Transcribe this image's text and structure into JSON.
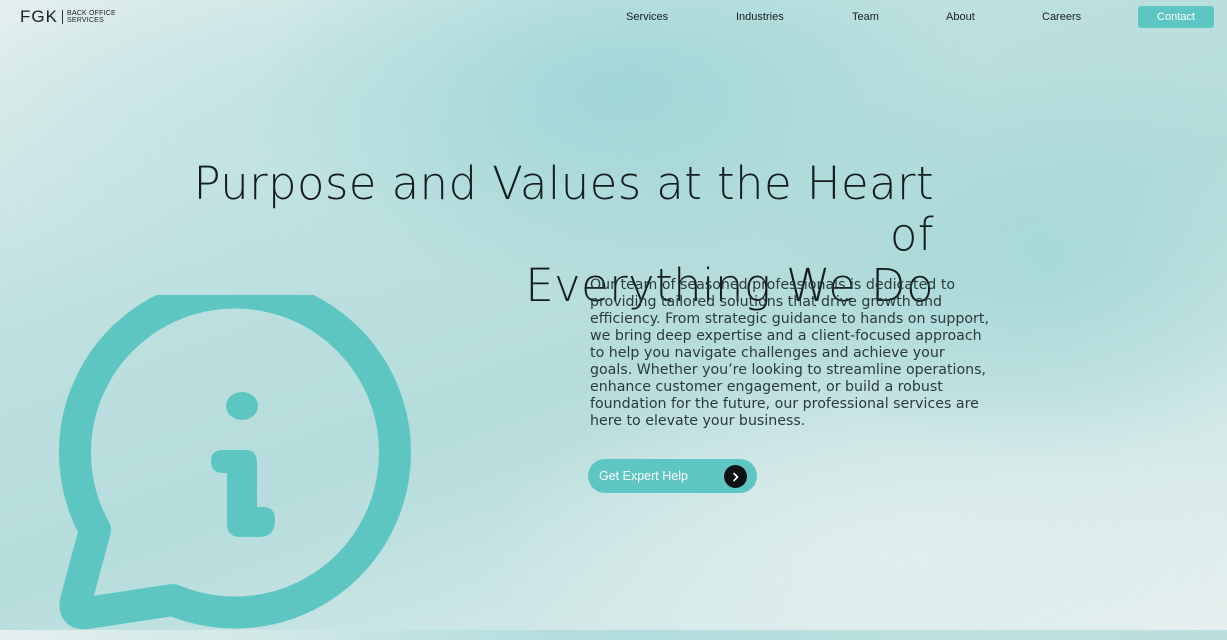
{
  "brand": {
    "mark": "FGK",
    "tagline_line1": "BACK OFFICE",
    "tagline_line2": "SERVICES"
  },
  "nav": {
    "items": [
      {
        "label": "Services"
      },
      {
        "label": "Industries"
      },
      {
        "label": "Team"
      },
      {
        "label": "About"
      },
      {
        "label": "Careers"
      }
    ],
    "contact_label": "Contact"
  },
  "hero": {
    "title_line1": "Purpose and Values at the Heart of",
    "title_line2": "Everything We Do",
    "description": "Our team of seasoned professionals is dedicated to providing tailored solutions that drive growth and efficiency. From strategic guidance to hands on support, we bring deep expertise and a client-focused approach to help you navigate challenges and achieve your goals. Whether you’re looking to streamline operations, enhance customer engagement, or build a robust foundation for the future, our professional services are here to elevate your business.",
    "cta_label": "Get Expert Help",
    "cta_icon": "arrow-right-icon",
    "illustration_icon": "info-speech-bubble-icon"
  },
  "colors": {
    "accent": "#5ec6c2",
    "text_dark": "#141c1d",
    "cta_arrow_bg": "#0c1213"
  }
}
